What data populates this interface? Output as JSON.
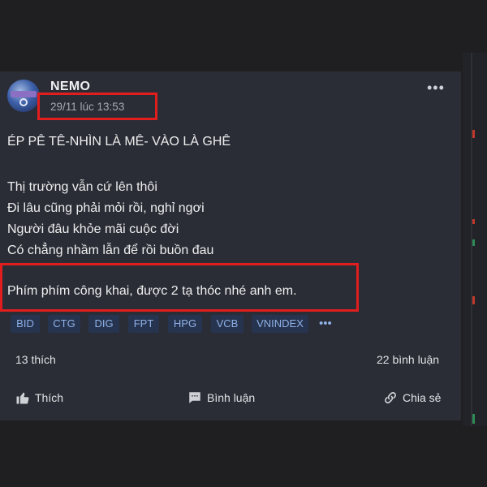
{
  "post": {
    "author": "NEMO",
    "timestamp": "29/11 lúc 13:53",
    "title": "ÉP PÊ TÊ-NHÌN LÀ MÊ- VÀO LÀ GHÊ",
    "poem": [
      "Thị trường vẫn cứ lên thôi",
      "Đi lâu cũng phải mỏi rồi, nghỉ ngơi",
      "Người đâu khỏe mãi cuộc đời",
      "Có chẳng nhầm lẫn để rồi buồn đau"
    ],
    "closing": "Phím phím công khai, được 2 tạ thóc nhé anh em.",
    "tags": [
      "BID",
      "CTG",
      "DIG",
      "FPT",
      "HPG",
      "VCB",
      "VNINDEX"
    ],
    "tags_more": "•••",
    "likes": "13 thích",
    "comments": "22 bình luận"
  },
  "actions": {
    "like": "Thích",
    "comment": "Bình luận",
    "share": "Chia sẻ"
  },
  "icons": {
    "more": "more-horizontal-icon",
    "like": "thumbs-up-icon",
    "comment": "comment-icon",
    "share": "share-icon"
  },
  "colors": {
    "highlight": "#e01e1e",
    "tag_bg": "#26344f",
    "tag_text": "#8fb0e6"
  }
}
